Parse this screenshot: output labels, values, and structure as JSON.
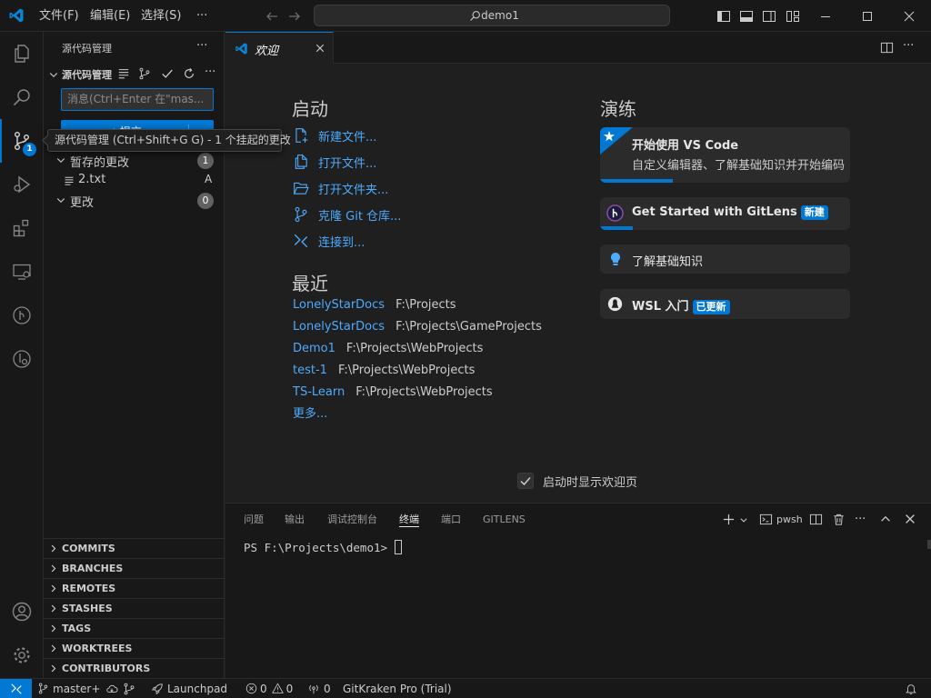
{
  "colors": {
    "accent": "#0078d4",
    "link": "#4daafc",
    "badge": "#0078d4"
  },
  "titlebar": {
    "menu": [
      "文件(F)",
      "编辑(E)",
      "选择(S)",
      "···"
    ],
    "search_text": "demo1"
  },
  "activity": {
    "scm_badge": "1"
  },
  "tooltip": {
    "text": "源代码管理 (Ctrl+Shift+G G) - 1 个挂起的更改"
  },
  "sidebar": {
    "title": "源代码管理",
    "more": "···",
    "repo_title": "源代码管理",
    "commit_input_placeholder": "消息(Ctrl+Enter 在\"mas...",
    "commit_button_label": "✓ 提交",
    "staged": {
      "label": "暂存的更改",
      "count": "1"
    },
    "file": {
      "name": "2.txt",
      "status": "A"
    },
    "changes": {
      "label": "更改",
      "count": "0"
    },
    "gitlens_sections": [
      "COMMITS",
      "BRANCHES",
      "REMOTES",
      "STASHES",
      "TAGS",
      "WORKTREES",
      "CONTRIBUTORS"
    ]
  },
  "tab": {
    "label": "欢迎"
  },
  "welcome": {
    "start_heading": "启动",
    "start_items": [
      "新建文件...",
      "打开文件...",
      "打开文件夹...",
      "克隆 Git 仓库...",
      "连接到..."
    ],
    "recent_heading": "最近",
    "recent": [
      {
        "name": "LonelyStarDocs",
        "path": "F:\\Projects"
      },
      {
        "name": "LonelyStarDocs",
        "path": "F:\\Projects\\GameProjects"
      },
      {
        "name": "Demo1",
        "path": "F:\\Projects\\WebProjects"
      },
      {
        "name": "test-1",
        "path": "F:\\Projects\\WebProjects"
      },
      {
        "name": "TS-Learn",
        "path": "F:\\Projects\\WebProjects"
      }
    ],
    "more": "更多...",
    "walkthrough_heading": "演练",
    "walkthroughs": [
      {
        "title": "开始使用 VS Code",
        "desc": "自定义编辑器、了解基础知识并开始编码",
        "progress": 0.29
      },
      {
        "title": "Get Started with GitLens",
        "pill": "新建",
        "progress": 0.13
      },
      {
        "title": "了解基础知识"
      },
      {
        "title": "WSL 入门",
        "pill": "已更新"
      }
    ],
    "show_on_startup": "启动时显示欢迎页"
  },
  "panel": {
    "tabs": [
      "问题",
      "输出",
      "调试控制台",
      "终端",
      "端口",
      "GITLENS"
    ],
    "active_tab": "终端",
    "terminal_name": "pwsh",
    "prompt": "PS F:\\Projects\\demo1> "
  },
  "statusbar": {
    "branch": "master+",
    "launchpad": "Launchpad",
    "errors": "0",
    "warnings": "0",
    "ports": "0",
    "gitkraken": "GitKraken Pro (Trial)"
  }
}
